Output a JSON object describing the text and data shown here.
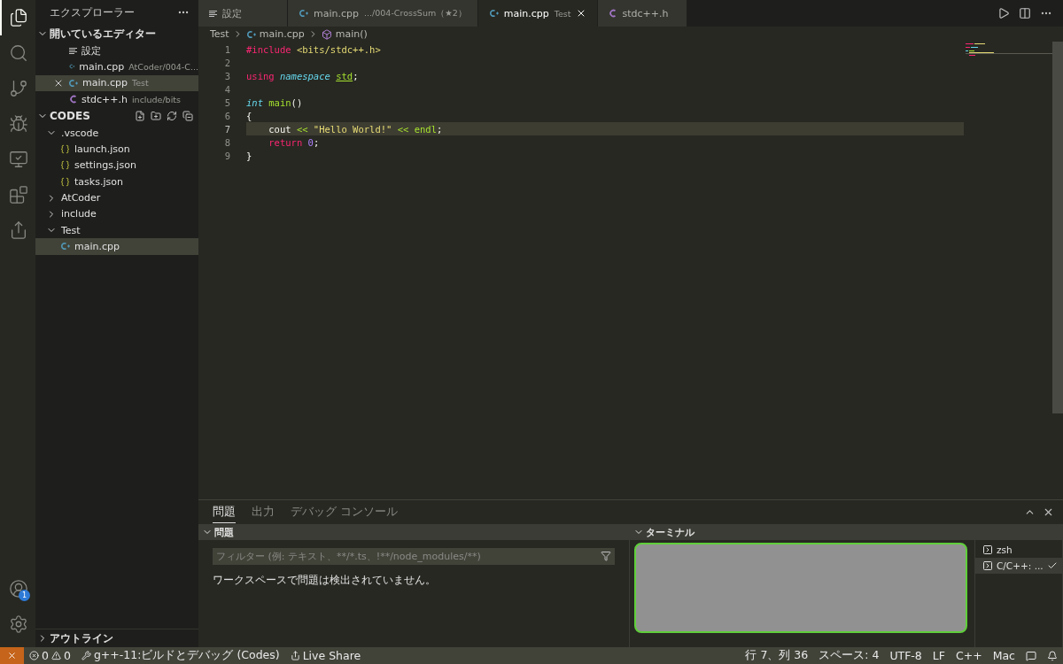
{
  "activity_bar": {
    "items": [
      {
        "kind": "explorer",
        "selected": true
      },
      {
        "kind": "search",
        "selected": false
      },
      {
        "kind": "source-control",
        "selected": false
      },
      {
        "kind": "run-debug",
        "selected": false
      },
      {
        "kind": "remote",
        "selected": false
      },
      {
        "kind": "extensions",
        "selected": false
      },
      {
        "kind": "live-share",
        "selected": false
      }
    ],
    "bottom": [
      {
        "kind": "accounts",
        "badge": "1"
      },
      {
        "kind": "settings"
      }
    ]
  },
  "sidebar": {
    "title": "エクスプローラー",
    "open_editors": {
      "label": "開いているエディター",
      "expanded": true,
      "items": [
        {
          "kind": "settings",
          "name": "設定",
          "selected": false
        },
        {
          "kind": "cpp",
          "name": "main.cpp",
          "detail": "AtCoder/004-C...",
          "selected": false
        },
        {
          "kind": "cpp",
          "name": "main.cpp",
          "detail": "Test",
          "selected": true
        },
        {
          "kind": "c",
          "name": "stdc++.h",
          "detail": "include/bits",
          "selected": false
        }
      ]
    },
    "workspace": {
      "label": "CODES",
      "expanded": true,
      "children": [
        {
          "kind": "folder",
          "name": ".vscode",
          "expanded": true,
          "selected": false,
          "children": [
            {
              "kind": "json",
              "name": "launch.json",
              "selected": false
            },
            {
              "kind": "json",
              "name": "settings.json",
              "selected": false
            },
            {
              "kind": "json",
              "name": "tasks.json",
              "selected": false
            }
          ]
        },
        {
          "kind": "folder",
          "name": "AtCoder",
          "expanded": false,
          "selected": false
        },
        {
          "kind": "folder",
          "name": "include",
          "expanded": false,
          "selected": false
        },
        {
          "kind": "folder",
          "name": "Test",
          "expanded": true,
          "selected": false,
          "children": [
            {
              "kind": "cpp",
              "name": "main.cpp",
              "selected": true
            }
          ]
        }
      ]
    },
    "outline": {
      "label": "アウトライン",
      "expanded": false
    }
  },
  "tabs": [
    {
      "kind": "settings",
      "name": "設定",
      "selected": false
    },
    {
      "kind": "cpp",
      "name": "main.cpp",
      "detail": ".../004-CrossSum（★2）",
      "selected": false
    },
    {
      "kind": "cpp",
      "name": "main.cpp",
      "detail": "Test",
      "selected": true
    },
    {
      "kind": "c",
      "name": "stdc++.h",
      "selected": false
    }
  ],
  "breadcrumb": [
    {
      "kind": "folder",
      "text": "Test"
    },
    {
      "kind": "cpp",
      "text": "main.cpp"
    },
    {
      "kind": "method",
      "text": "main()"
    }
  ],
  "code": {
    "lines": [
      {
        "number": "1",
        "current": false,
        "tokens": [
          {
            "kind": "keyword",
            "text": "#include"
          },
          {
            "kind": "string",
            "text": " <bits/stdc++.h>"
          }
        ]
      },
      {
        "number": "2",
        "current": false
      },
      {
        "number": "3",
        "current": false,
        "tokens": [
          {
            "kind": "keyword",
            "text": "using"
          },
          {
            "kind": "type",
            "text": " namespace "
          },
          {
            "kind": "ns",
            "text": "std"
          },
          {
            "kind": "plain",
            "text": ";"
          }
        ]
      },
      {
        "number": "4",
        "current": false
      },
      {
        "number": "5",
        "current": false,
        "tokens": [
          {
            "kind": "type",
            "text": "int"
          },
          {
            "kind": "function",
            "text": " main"
          },
          {
            "kind": "plain",
            "text": "()"
          }
        ]
      },
      {
        "number": "6",
        "current": false,
        "tokens": [
          {
            "kind": "plain",
            "text": "{"
          }
        ]
      },
      {
        "number": "7",
        "current": true,
        "tokens": [
          {
            "kind": "plain",
            "text": "    cout"
          },
          {
            "kind": "function",
            "text": " <<"
          },
          {
            "kind": "string",
            "text": " \"Hello World!\""
          },
          {
            "kind": "function",
            "text": " <<"
          },
          {
            "kind": "function",
            "text": " endl"
          },
          {
            "kind": "plain",
            "text": ";"
          }
        ]
      },
      {
        "number": "8",
        "current": false,
        "tokens": [
          {
            "kind": "keyword",
            "text": "    return"
          },
          {
            "kind": "number",
            "text": " 0"
          },
          {
            "kind": "plain",
            "text": ";"
          }
        ]
      },
      {
        "number": "9",
        "current": false,
        "tokens": [
          {
            "kind": "plain",
            "text": "}"
          }
        ]
      }
    ]
  },
  "panel": {
    "tabs": [
      {
        "label": "問題",
        "selected": true
      },
      {
        "label": "出力",
        "selected": false
      },
      {
        "label": "デバッグ コンソール",
        "selected": false
      }
    ],
    "problems": {
      "label": "問題",
      "expanded": true,
      "filter_placeholder": "フィルター (例: テキスト、**/*.ts、!**/node_modules/**)",
      "message": "ワークスペースで問題は検出されていません。"
    },
    "terminal": {
      "label": "ターミナル",
      "expanded": true,
      "sessions": [
        {
          "name": "zsh",
          "selected": false,
          "succeeded": false
        },
        {
          "name": "C/C++: ...",
          "selected": true,
          "succeeded": true
        }
      ]
    }
  },
  "status_bar": {
    "errors": "0",
    "warnings": "0",
    "task": "g++-11:ビルドとデバッグ (Codes)",
    "live_share": "Live Share",
    "right": [
      "行 7、列 36",
      "スペース: 4",
      "UTF-8",
      "LF",
      "C++",
      "Mac"
    ]
  }
}
